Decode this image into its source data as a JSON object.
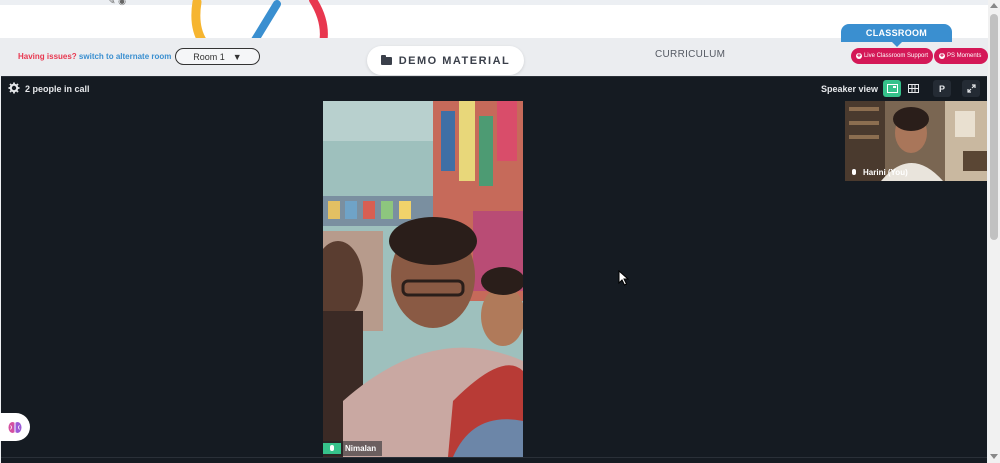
{
  "toolbar": {
    "issue_prefix": "Having issues?",
    "issue_link": "switch to alternate room",
    "room_value": "Room 1",
    "demo_material_label": "DEMO MATERIAL",
    "curriculum_label": "CURRICULUM",
    "classroom_tab_label": "CLASSROOM",
    "live_support_label": "Live Classroom Support",
    "moments_label": "PS Moments"
  },
  "call": {
    "people_count": "2 people in call",
    "speaker_view_label": "Speaker view",
    "p_button_label": "P",
    "main_participant": "Nimalan",
    "self_participant": "Harini (You)"
  },
  "icons": [
    "pencil-icon",
    "eye-icon",
    "folder-icon",
    "gear-icon",
    "speaker-view-icon",
    "grid-view-icon",
    "fullscreen-icon",
    "mic-icon",
    "brain-icon",
    "cursor-icon"
  ],
  "colors": {
    "accent_green": "#36c28b",
    "pill_pink": "#d41857",
    "link_blue": "#3a8fd0",
    "issue_red": "#e8374f",
    "call_bg": "#151b22"
  }
}
